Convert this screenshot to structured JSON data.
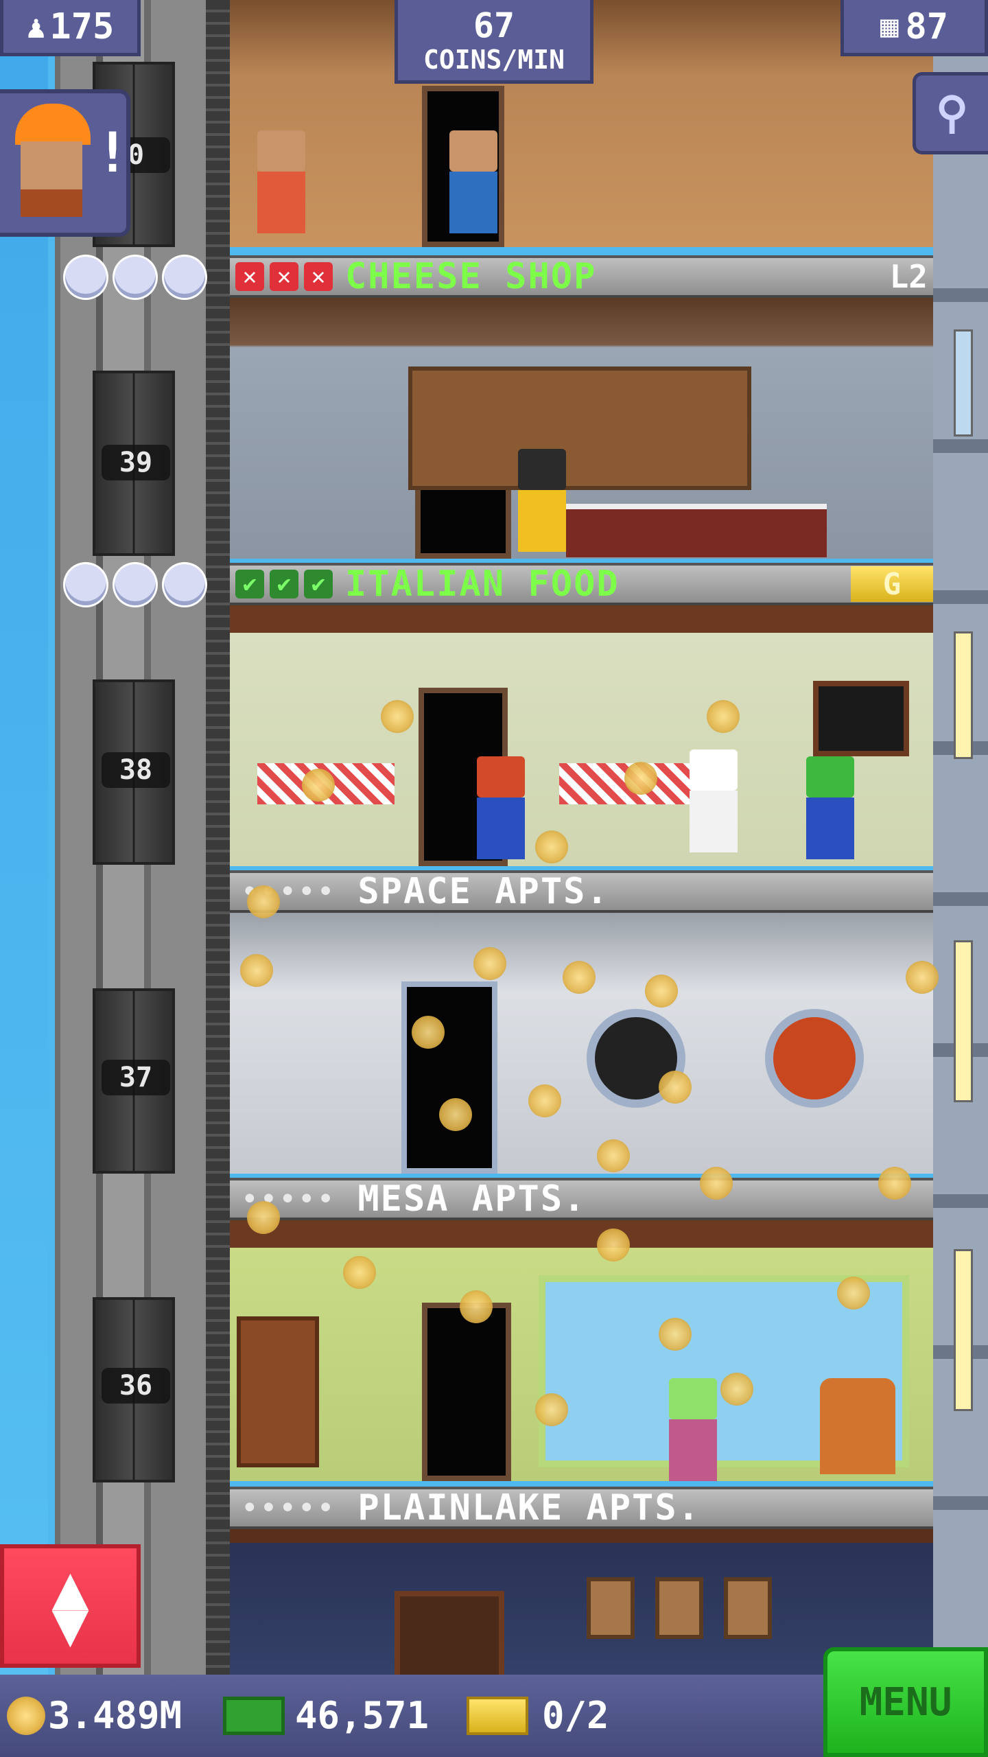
{
  "hud": {
    "population": "175",
    "coins_rate_value": "67",
    "coins_rate_unit": "COINS/MIN",
    "floors_count": "87",
    "coins_total": "3.489M",
    "bux_total": "46,571",
    "vip_tickets": "0/2",
    "menu_label": "MENU",
    "builder_alert": "!"
  },
  "elevator": {
    "floor_numbers": [
      "0",
      "39",
      "38",
      "37",
      "36"
    ]
  },
  "floors": [
    {
      "name": "CHEESE SHOP",
      "level": "L2",
      "status": "stocking-needed"
    },
    {
      "name": "ITALIAN FOOD",
      "level": "G",
      "status": "stocked"
    },
    {
      "name": "SPACE APTS.",
      "residents_dots": "•••••"
    },
    {
      "name": "MESA APTS.",
      "residents_dots": "•••••"
    },
    {
      "name": "PLAINLAKE APTS.",
      "residents_dots": "•••••"
    }
  ],
  "colors": {
    "shop_name_green": "#7dff4a",
    "apt_name_white": "#ffffff",
    "hud_purple": "#5b5e96",
    "menu_green": "#33cc33",
    "elevator_red": "#e8334a"
  },
  "icons": [
    "person-icon",
    "floors-icon",
    "search-icon",
    "coin-icon",
    "bux-icon",
    "vip-ticket-icon",
    "elevator-updown-icon",
    "builder-avatar-icon",
    "star-icon",
    "x-mark-icon",
    "check-mark-icon"
  ]
}
